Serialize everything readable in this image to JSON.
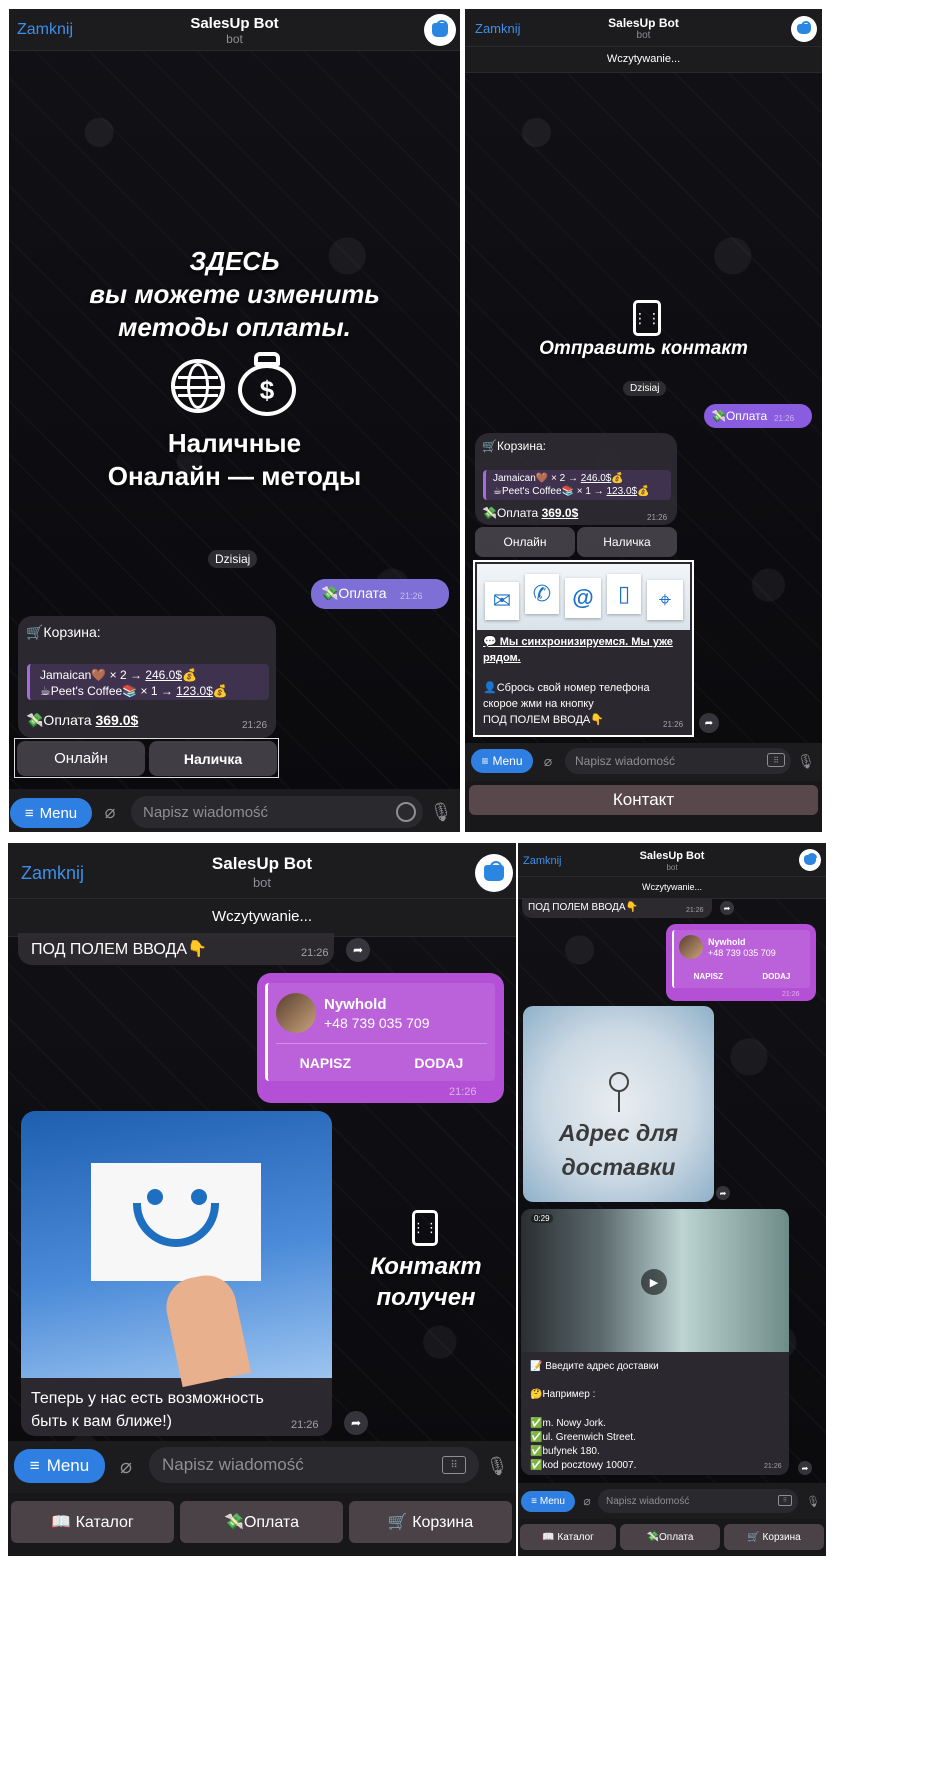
{
  "common": {
    "close": "Zamknij",
    "bot_title": "SalesUp Bot",
    "bot_sub": "bot",
    "loading": "Wczytywanie...",
    "date": "Dzisiaj",
    "menu": "Menu",
    "placeholder": "Napisz wiadomość",
    "time": "21:26",
    "avatar_brand": "SalesUp"
  },
  "cart": {
    "title": "🛒Корзина:",
    "item1_name": "Jamaican🤎  × 2 → ",
    "item1_price": "246.0$",
    "item1_emoji": "💰",
    "item2_name": "☕Peet's Coffee📚  × 1 → ",
    "item2_price": "123.0$",
    "item2_emoji": "💰",
    "total_label": "💸Оплата ",
    "total_value": "369.0$",
    "btn_online": "Онлайн",
    "btn_cash": "Наличка"
  },
  "payment_msg": "💸Оплата",
  "panel1": {
    "overlay_line1": "ЗДЕСЬ",
    "overlay_line2": "вы можете изменить",
    "overlay_line3": "методы оплаты.",
    "overlay_line4": "Наличные",
    "overlay_line5": "Оналайн — методы"
  },
  "panel2": {
    "overlay_send": "Отправить контакт",
    "sync_line": "💬  Мы синхронизируемся. Мы уже рядом.",
    "drop_line1": "👤Сбрось свой номер телефона",
    "drop_line2": "скорое жми на кнопку",
    "drop_line3": "ПОД ПОЛЕМ ВВОДА👇",
    "contact_button": "Контакт"
  },
  "panel3": {
    "prev_line": "ПОД ПОЛЕМ ВВОДА👇",
    "contact_name": "Nywhold",
    "contact_phone": "+48 739 035 709",
    "napisz": "NAPISZ",
    "dodaj": "DODAJ",
    "overlay_line1": "Контакт",
    "overlay_line2": "получен",
    "closer_line1": "Теперь у нас есть возможность",
    "closer_line2": "быть к вам ближе!)",
    "kbd_catalog": "📖 Каталог",
    "kbd_payment": "💸Оплата",
    "kbd_cart": "🛒 Корзина"
  },
  "panel4": {
    "prev_line": "ПОД ПОЛЕМ ВВОДА👇",
    "contact_name": "Nywhold",
    "contact_phone": "+48 739 035 709",
    "napisz": "NAPISZ",
    "dodaj": "DODAJ",
    "addr_overlay1": "Адрес для",
    "addr_overlay2": "доставки",
    "video_duration": "0:29",
    "addr_line": "📝 Введите адрес доставки",
    "example": "🤔Например :",
    "ex1": "✅m. Nowy Jork.",
    "ex2": "✅ul. Greenwich Street.",
    "ex3": "✅bufynek 180.",
    "ex4": "✅kod pocztowy 10007.",
    "kbd_catalog": "📖 Каталог",
    "kbd_payment": "💸Оплата",
    "kbd_cart": "🛒 Корзина"
  }
}
